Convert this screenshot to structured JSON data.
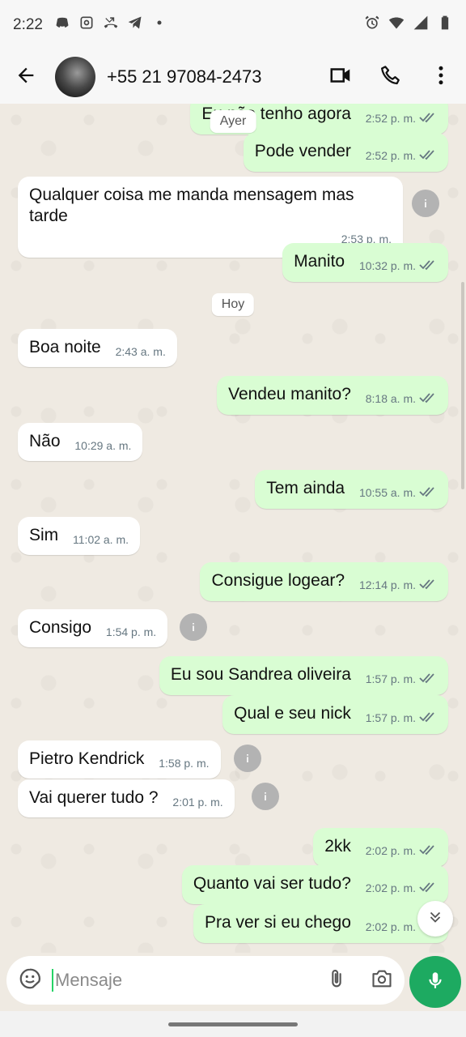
{
  "status_bar": {
    "time": "2:22",
    "icons": [
      "discord-icon",
      "instagram-icon",
      "missed-call-icon",
      "telegram-icon",
      "dot-icon",
      "alarm-icon",
      "wifi-icon",
      "signal-icon",
      "battery-icon"
    ]
  },
  "header": {
    "contact_name": "+55 21 97084-2473",
    "actions": [
      "video-call-icon",
      "voice-call-icon",
      "more-options-icon"
    ]
  },
  "chat": {
    "date_chips": {
      "yesterday": "Ayer",
      "today": "Hoy"
    },
    "messages": [
      {
        "dir": "out",
        "text": "Eu não tenho agora",
        "time": "2:52 p. m."
      },
      {
        "dir": "out",
        "text": "Pode vender",
        "time": "2:52 p. m."
      },
      {
        "dir": "in",
        "text": "Qualquer coisa me manda mensagem mas tarde",
        "time": "2:53 p. m."
      },
      {
        "dir": "out",
        "text": "Manito",
        "time": "10:32 p. m."
      },
      {
        "dir": "in",
        "text": "Boa noite",
        "time": "2:43 a. m."
      },
      {
        "dir": "out",
        "text": "Vendeu manito?",
        "time": "8:18 a. m."
      },
      {
        "dir": "in",
        "text": "Não",
        "time": "10:29 a. m."
      },
      {
        "dir": "out",
        "text": "Tem ainda",
        "time": "10:55 a. m."
      },
      {
        "dir": "in",
        "text": "Sim",
        "time": "11:02 a. m."
      },
      {
        "dir": "out",
        "text": "Consigue logear?",
        "time": "12:14 p. m."
      },
      {
        "dir": "in",
        "text": "Consigo",
        "time": "1:54 p. m."
      },
      {
        "dir": "out",
        "text": "Eu sou Sandrea oliveira",
        "time": "1:57 p. m."
      },
      {
        "dir": "out",
        "text": "Qual e seu nick",
        "time": "1:57 p. m."
      },
      {
        "dir": "in",
        "text": "Pietro Kendrick",
        "time": "1:58 p. m."
      },
      {
        "dir": "in",
        "text": "Vai querer tudo ?",
        "time": "2:01 p. m."
      },
      {
        "dir": "out",
        "text": "2kk",
        "time": "2:02 p. m."
      },
      {
        "dir": "out",
        "text": "Quanto vai ser tudo?",
        "time": "2:02 p. m."
      },
      {
        "dir": "out",
        "text": "Pra ver si eu chego",
        "time": "2:02 p. m."
      }
    ]
  },
  "composer": {
    "placeholder": "Mensaje"
  },
  "colors": {
    "outgoing_bubble": "#d9fdd3",
    "incoming_bubble": "#ffffff",
    "chat_background": "#efeae2",
    "read_ticks": "#667781",
    "mic_button": "#1daa61"
  }
}
